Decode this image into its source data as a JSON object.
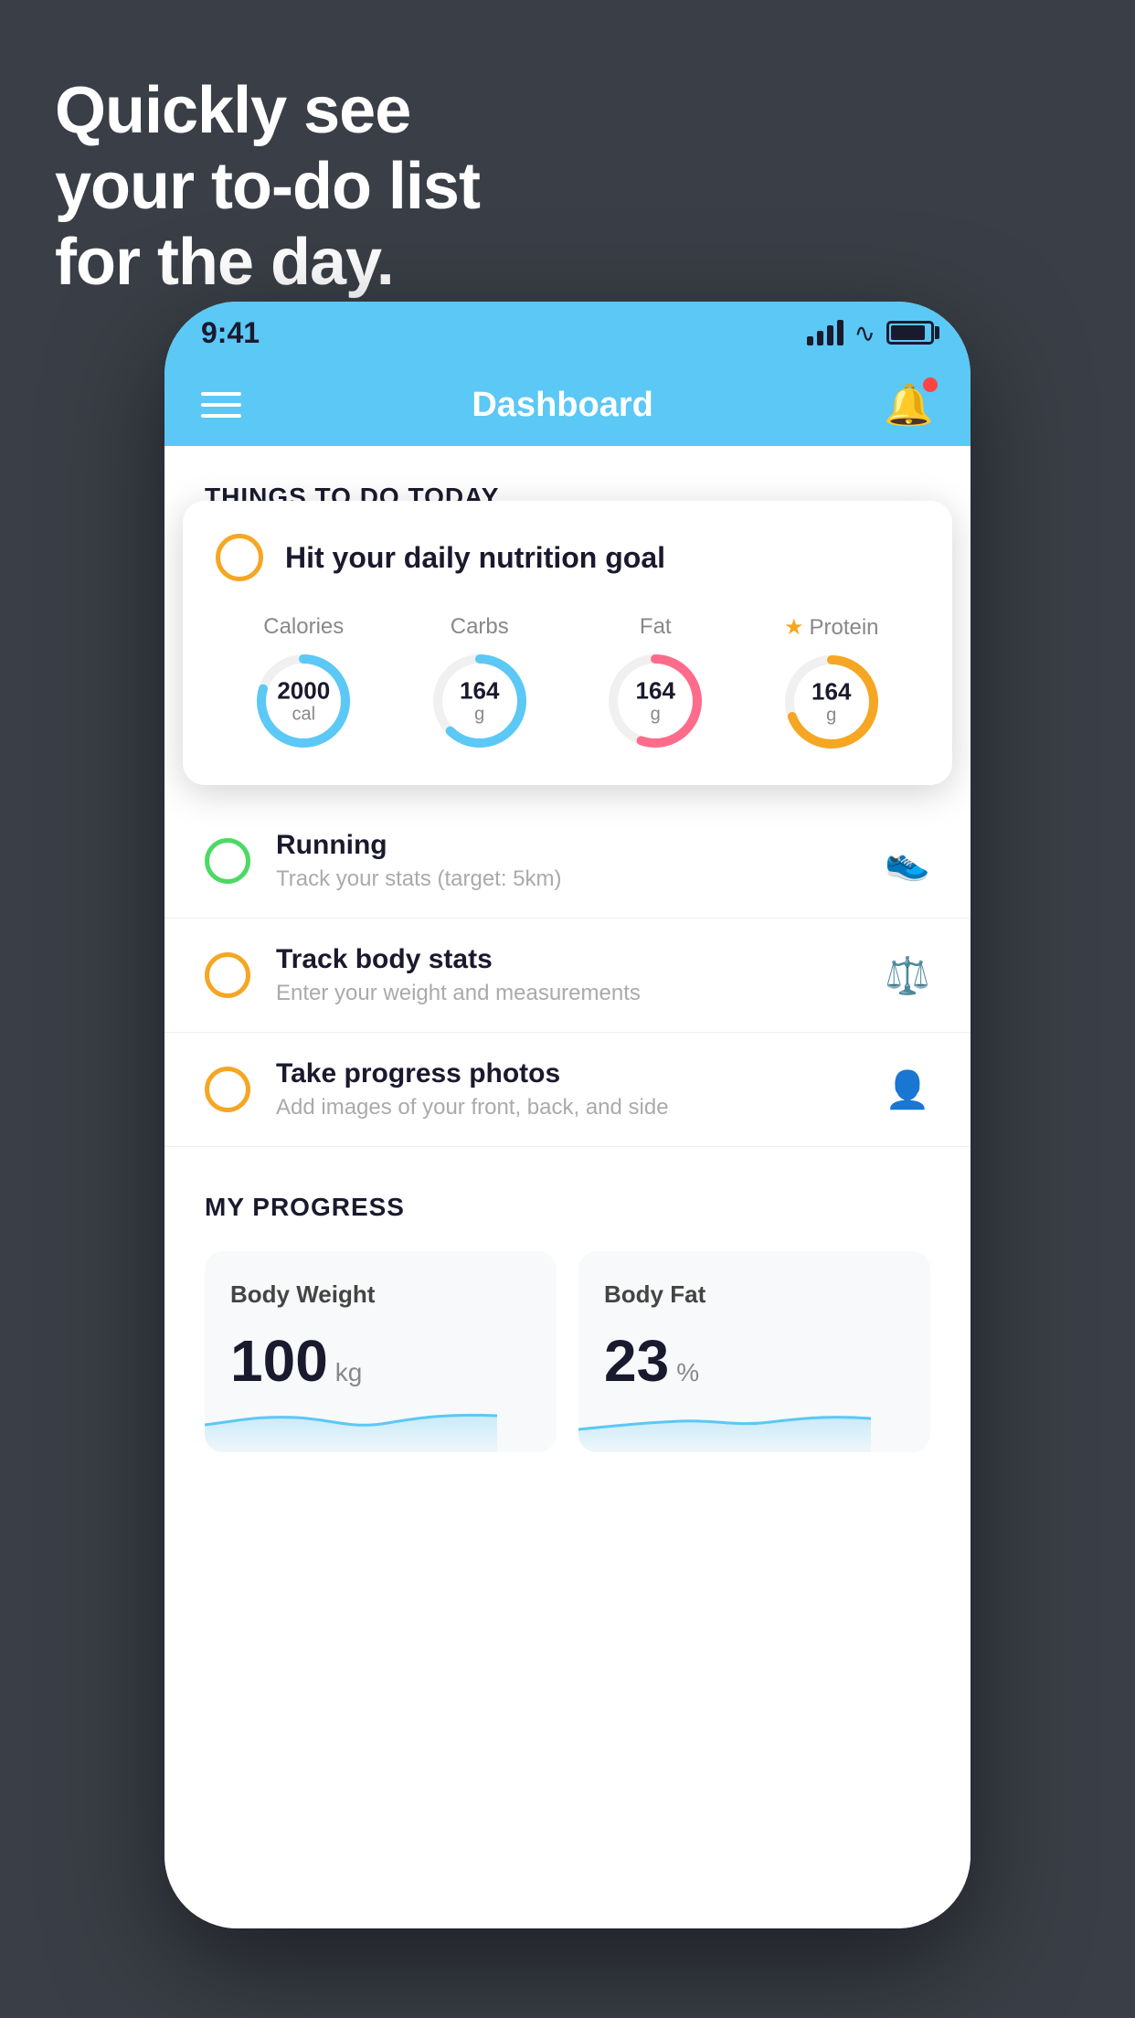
{
  "background": {
    "headline_line1": "Quickly see",
    "headline_line2": "your to-do list",
    "headline_line3": "for the day."
  },
  "status_bar": {
    "time": "9:41"
  },
  "header": {
    "title": "Dashboard"
  },
  "things_section": {
    "label": "THINGS TO DO TODAY"
  },
  "nutrition_card": {
    "title": "Hit your daily nutrition goal",
    "calories_label": "Calories",
    "calories_value": "2000",
    "calories_unit": "cal",
    "carbs_label": "Carbs",
    "carbs_value": "164",
    "carbs_unit": "g",
    "fat_label": "Fat",
    "fat_value": "164",
    "fat_unit": "g",
    "protein_label": "Protein",
    "protein_value": "164",
    "protein_unit": "g"
  },
  "todo_items": [
    {
      "id": "running",
      "title": "Running",
      "subtitle": "Track your stats (target: 5km)",
      "icon": "🏃",
      "circle_color": "green"
    },
    {
      "id": "body-stats",
      "title": "Track body stats",
      "subtitle": "Enter your weight and measurements",
      "icon": "⚖️",
      "circle_color": "yellow"
    },
    {
      "id": "progress-photos",
      "title": "Take progress photos",
      "subtitle": "Add images of your front, back, and side",
      "icon": "👤",
      "circle_color": "yellow"
    }
  ],
  "progress_section": {
    "label": "MY PROGRESS",
    "body_weight_label": "Body Weight",
    "body_weight_value": "100",
    "body_weight_unit": "kg",
    "body_fat_label": "Body Fat",
    "body_fat_value": "23",
    "body_fat_unit": "%"
  },
  "colors": {
    "header_bg": "#5bc8f5",
    "accent_yellow": "#f5a623",
    "accent_green": "#4cd964",
    "accent_pink": "#ff6b8a",
    "background": "#3a3f47"
  }
}
